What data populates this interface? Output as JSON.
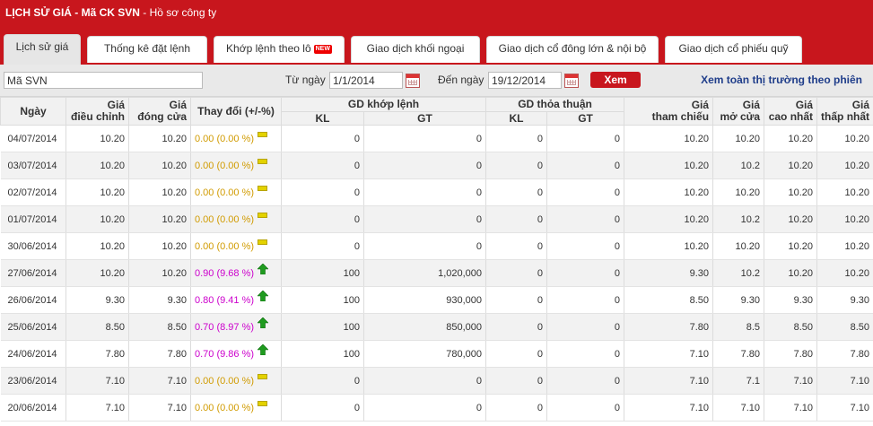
{
  "header": {
    "title_bold": "LỊCH SỬ GIÁ - Mã CK SVN",
    "title_rest": " - Hồ sơ công ty"
  },
  "tabs": [
    {
      "label": "Lịch sử giá"
    },
    {
      "label": "Thống kê đặt lệnh"
    },
    {
      "label": "Khớp lệnh theo lô",
      "badge": "NEW"
    },
    {
      "label": "Giao dịch khối ngoại"
    },
    {
      "label": "Giao dịch cổ đông lớn & nội bộ"
    },
    {
      "label": "Giao dịch cổ phiếu quỹ"
    }
  ],
  "filter": {
    "symbol_value": "Mã SVN",
    "from_label": "Từ ngày",
    "from_value": "1/1/2014",
    "to_label": "Đến ngày",
    "to_value": "19/12/2014",
    "button": "Xem",
    "view_all": "Xem toàn thị trường theo phiên"
  },
  "columns": {
    "date": "Ngày",
    "adj_l1": "Giá",
    "adj_l2": "điều chỉnh",
    "close_l1": "Giá",
    "close_l2": "đóng cửa",
    "change": "Thay đổi (+/-%)",
    "matched": "GD khớp lệnh",
    "negotiated": "GD thỏa thuận",
    "kl": "KL",
    "gt": "GT",
    "ref_l1": "Giá",
    "ref_l2": "tham chiếu",
    "open_l1": "Giá",
    "open_l2": "mở cửa",
    "high_l1": "Giá",
    "high_l2": "cao nhất",
    "low_l1": "Giá",
    "low_l2": "thấp nhất"
  },
  "rows": [
    {
      "date": "04/07/2014",
      "adj": "10.20",
      "close": "10.20",
      "change": "0.00 (0.00 %)",
      "dir": "flat",
      "kl": "0",
      "gt": "0",
      "tt_kl": "0",
      "tt_gt": "0",
      "ref": "10.20",
      "open": "10.20",
      "high": "10.20",
      "low": "10.20"
    },
    {
      "date": "03/07/2014",
      "adj": "10.20",
      "close": "10.20",
      "change": "0.00 (0.00 %)",
      "dir": "flat",
      "kl": "0",
      "gt": "0",
      "tt_kl": "0",
      "tt_gt": "0",
      "ref": "10.20",
      "open": "10.2",
      "high": "10.20",
      "low": "10.20"
    },
    {
      "date": "02/07/2014",
      "adj": "10.20",
      "close": "10.20",
      "change": "0.00 (0.00 %)",
      "dir": "flat",
      "kl": "0",
      "gt": "0",
      "tt_kl": "0",
      "tt_gt": "0",
      "ref": "10.20",
      "open": "10.20",
      "high": "10.20",
      "low": "10.20"
    },
    {
      "date": "01/07/2014",
      "adj": "10.20",
      "close": "10.20",
      "change": "0.00 (0.00 %)",
      "dir": "flat",
      "kl": "0",
      "gt": "0",
      "tt_kl": "0",
      "tt_gt": "0",
      "ref": "10.20",
      "open": "10.2",
      "high": "10.20",
      "low": "10.20"
    },
    {
      "date": "30/06/2014",
      "adj": "10.20",
      "close": "10.20",
      "change": "0.00 (0.00 %)",
      "dir": "flat",
      "kl": "0",
      "gt": "0",
      "tt_kl": "0",
      "tt_gt": "0",
      "ref": "10.20",
      "open": "10.20",
      "high": "10.20",
      "low": "10.20"
    },
    {
      "date": "27/06/2014",
      "adj": "10.20",
      "close": "10.20",
      "change": "0.90 (9.68 %)",
      "dir": "up",
      "kl": "100",
      "gt": "1,020,000",
      "tt_kl": "0",
      "tt_gt": "0",
      "ref": "9.30",
      "open": "10.2",
      "high": "10.20",
      "low": "10.20"
    },
    {
      "date": "26/06/2014",
      "adj": "9.30",
      "close": "9.30",
      "change": "0.80 (9.41 %)",
      "dir": "up",
      "kl": "100",
      "gt": "930,000",
      "tt_kl": "0",
      "tt_gt": "0",
      "ref": "8.50",
      "open": "9.30",
      "high": "9.30",
      "low": "9.30"
    },
    {
      "date": "25/06/2014",
      "adj": "8.50",
      "close": "8.50",
      "change": "0.70 (8.97 %)",
      "dir": "up",
      "kl": "100",
      "gt": "850,000",
      "tt_kl": "0",
      "tt_gt": "0",
      "ref": "7.80",
      "open": "8.5",
      "high": "8.50",
      "low": "8.50"
    },
    {
      "date": "24/06/2014",
      "adj": "7.80",
      "close": "7.80",
      "change": "0.70 (9.86 %)",
      "dir": "up",
      "kl": "100",
      "gt": "780,000",
      "tt_kl": "0",
      "tt_gt": "0",
      "ref": "7.10",
      "open": "7.80",
      "high": "7.80",
      "low": "7.80"
    },
    {
      "date": "23/06/2014",
      "adj": "7.10",
      "close": "7.10",
      "change": "0.00 (0.00 %)",
      "dir": "flat",
      "kl": "0",
      "gt": "0",
      "tt_kl": "0",
      "tt_gt": "0",
      "ref": "7.10",
      "open": "7.1",
      "high": "7.10",
      "low": "7.10"
    },
    {
      "date": "20/06/2014",
      "adj": "7.10",
      "close": "7.10",
      "change": "0.00 (0.00 %)",
      "dir": "flat",
      "kl": "0",
      "gt": "0",
      "tt_kl": "0",
      "tt_gt": "0",
      "ref": "7.10",
      "open": "7.10",
      "high": "7.10",
      "low": "7.10"
    }
  ],
  "colors": {
    "brand": "#c8161d",
    "zero_change": "#d19b00",
    "positive_change": "#cc00cc",
    "link": "#1f3d8a"
  },
  "icons": {
    "flat": "flat-bar-icon",
    "up": "up-arrow-icon",
    "calendar": "calendar-icon"
  }
}
